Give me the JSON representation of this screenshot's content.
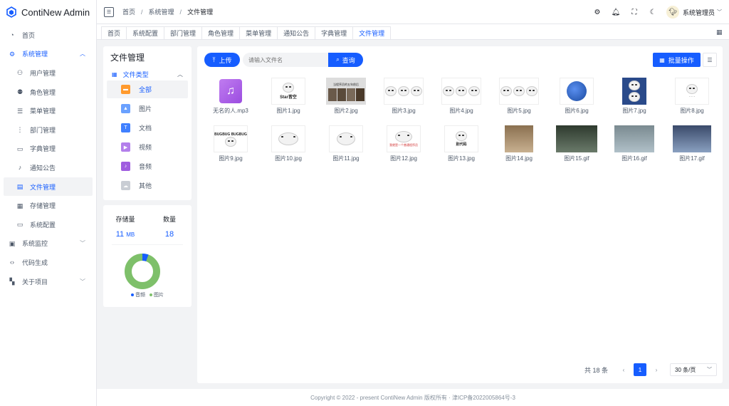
{
  "app": {
    "title": "ContiNew Admin"
  },
  "sidebar": {
    "items": [
      {
        "label": "首页",
        "icon": "dashboard-icon"
      },
      {
        "label": "系统管理",
        "icon": "settings-icon"
      },
      {
        "label": "用户管理",
        "icon": "user-icon"
      },
      {
        "label": "角色管理",
        "icon": "user-group-icon"
      },
      {
        "label": "菜单管理",
        "icon": "menu-icon"
      },
      {
        "label": "部门管理",
        "icon": "tree-icon"
      },
      {
        "label": "字典管理",
        "icon": "book-icon"
      },
      {
        "label": "通知公告",
        "icon": "bell-icon"
      },
      {
        "label": "文件管理",
        "icon": "file-icon"
      },
      {
        "label": "存储管理",
        "icon": "storage-icon"
      },
      {
        "label": "系统配置",
        "icon": "desktop-icon"
      },
      {
        "label": "系统监控",
        "icon": "computer-icon"
      },
      {
        "label": "代码生成",
        "icon": "code-icon"
      },
      {
        "label": "关于项目",
        "icon": "apps-icon"
      }
    ]
  },
  "header": {
    "breadcrumb": [
      "首页",
      "系统管理",
      "文件管理"
    ],
    "user_name": "系统管理员"
  },
  "tabs": [
    "首页",
    "系统配置",
    "部门管理",
    "角色管理",
    "菜单管理",
    "通知公告",
    "字典管理",
    "文件管理"
  ],
  "file_panel": {
    "title": "文件管理",
    "type_group": "文件类型",
    "types": [
      {
        "label": "全部",
        "color": "#ff9a2e"
      },
      {
        "label": "图片",
        "color": "#6aa1ff"
      },
      {
        "label": "文档",
        "color": "#4080ff"
      },
      {
        "label": "视频",
        "color": "#b37feb"
      },
      {
        "label": "音频",
        "color": "#9f5ddf"
      },
      {
        "label": "其他",
        "color": "#c9cdd4"
      }
    ]
  },
  "stats": {
    "storage_label": "存储量",
    "storage_value": "11",
    "storage_unit": "MB",
    "count_label": "数量",
    "count_value": "18",
    "legend": [
      {
        "label": "音频",
        "color": "#165dff"
      },
      {
        "label": "图片",
        "color": "#7ec06a"
      }
    ],
    "donut": {
      "audio": 1,
      "image": 17
    }
  },
  "toolbar": {
    "upload_label": "上传",
    "search_placeholder": "请输入文件名",
    "search_label": "查询",
    "batch_label": "批量操作"
  },
  "files": [
    "无名的人.mp3",
    "图片1.jpg",
    "图片2.jpg",
    "图片3.jpg",
    "图片4.jpg",
    "图片5.jpg",
    "图片6.jpg",
    "图片7.jpg",
    "图片8.jpg",
    "图片9.jpg",
    "图片10.jpg",
    "图片11.jpg",
    "图片12.jpg",
    "图片13.jpg",
    "图片14.jpg",
    "图片15.gif",
    "图片16.gif",
    "图片17.gif"
  ],
  "thumb_texts": {
    "t1": "Star皆空",
    "t2": "当程序员的五年前后",
    "t9": "BUGBUG BUGBUG",
    "t12": "我就是一个普通程序员",
    "t13": "别代码"
  },
  "pager": {
    "total": "共 18 条",
    "current": "1",
    "page_size": "30 条/页"
  },
  "footer": {
    "text": "Copyright © 2022 - present ContiNew Admin 版权所有 · 津ICP备2022005864号-3"
  }
}
